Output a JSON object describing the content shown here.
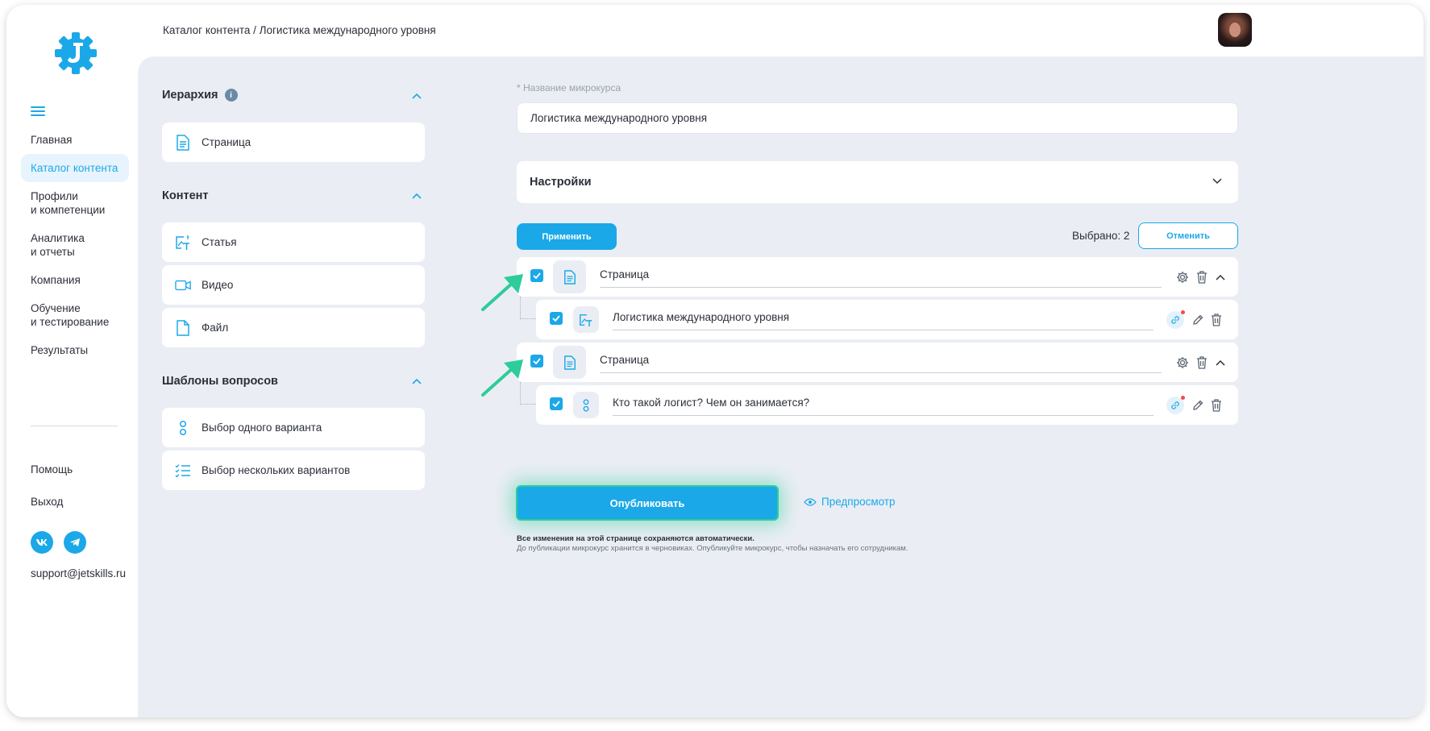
{
  "breadcrumb": "Каталог контента / Логистика международного уровня",
  "sidebar": {
    "items": [
      {
        "label": "Главная"
      },
      {
        "label": "Каталог контента"
      },
      {
        "label": "Профили\nи компетенции"
      },
      {
        "label": "Аналитика\nи отчеты"
      },
      {
        "label": "Компания"
      },
      {
        "label": "Обучение\nи тестирование"
      },
      {
        "label": "Результаты"
      }
    ],
    "help": "Помощь",
    "exit": "Выход",
    "social": {
      "vk": "vk",
      "telegram": "telegram"
    },
    "email": "support@jetskills.ru"
  },
  "left_panel": {
    "hierarchy": {
      "title": "Иерархия",
      "info": "i",
      "items": [
        {
          "label": "Страница",
          "icon": "page-icon"
        }
      ]
    },
    "content": {
      "title": "Контент",
      "items": [
        {
          "label": "Статья",
          "icon": "article-icon"
        },
        {
          "label": "Видео",
          "icon": "video-icon"
        },
        {
          "label": "Файл",
          "icon": "file-icon"
        }
      ]
    },
    "templates": {
      "title": "Шаблоны вопросов",
      "items": [
        {
          "label": "Выбор одного варианта",
          "icon": "single-choice-icon"
        },
        {
          "label": "Выбор нескольких вариантов",
          "icon": "multi-choice-icon"
        }
      ]
    }
  },
  "form": {
    "name_label": "* Название микрокурса",
    "name_value": "Логистика международного уровня",
    "settings_title": "Настройки",
    "apply_label": "Применить",
    "selected_label": "Выбрано: 2",
    "cancel_label": "Отменить"
  },
  "structure": [
    {
      "title": "Страница",
      "checked": true,
      "child": {
        "title": "Логистика международного уровня",
        "checked": true,
        "type": "article"
      }
    },
    {
      "title": "Страница",
      "checked": true,
      "child": {
        "title": "Кто такой логист? Чем он занимается?",
        "checked": true,
        "type": "question"
      }
    }
  ],
  "footer": {
    "publish_label": "Опубликовать",
    "preview_label": "Предпросмотр",
    "note_bold": "Все изменения на этой странице сохраняются автоматически.",
    "note": "До публикации микрокурс хранится в черновиках. Опубликуйте микрокурс, чтобы назначать его сотрудникам."
  },
  "colors": {
    "accent": "#1ba8e8",
    "highlight": "#2ecc9a",
    "background": "#eaeef4"
  }
}
